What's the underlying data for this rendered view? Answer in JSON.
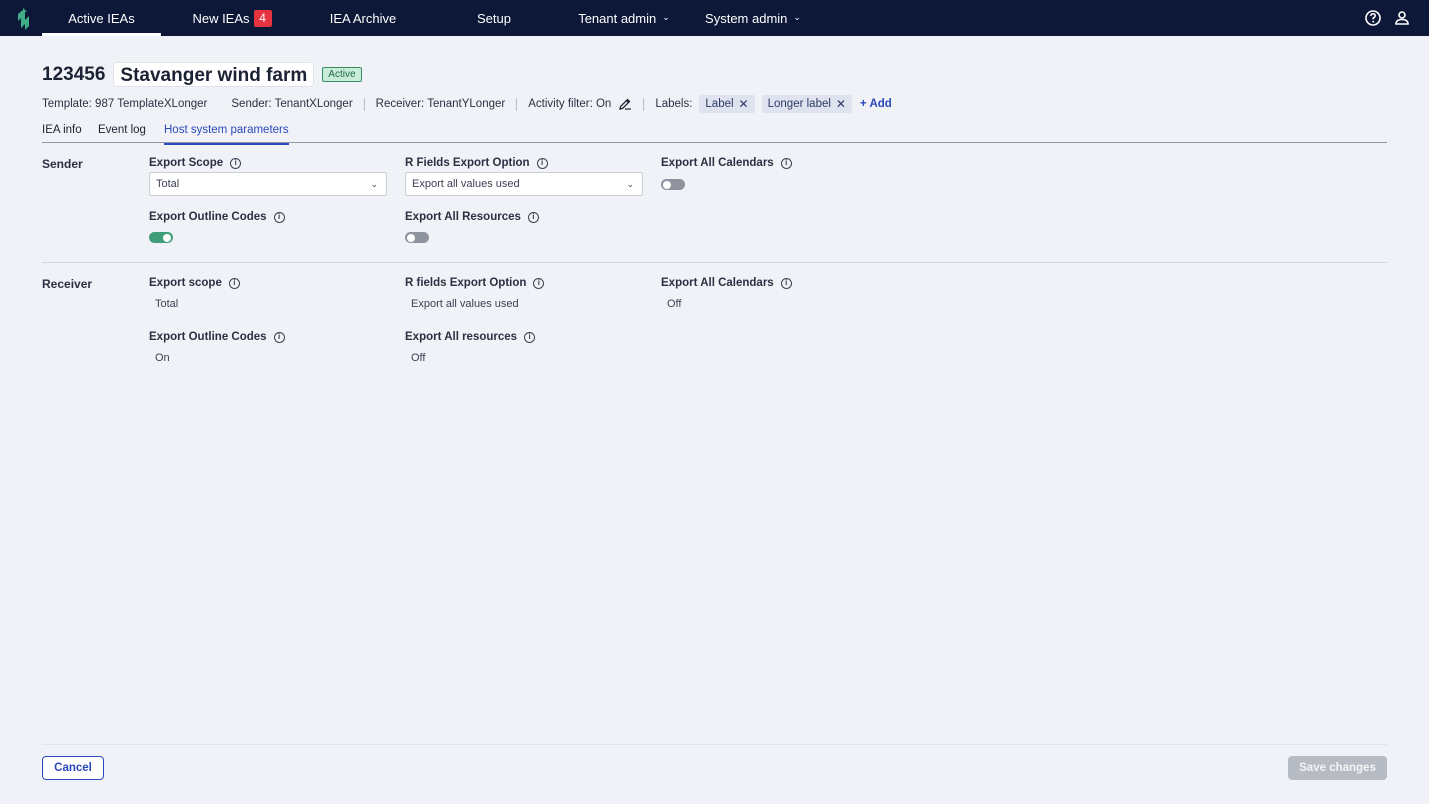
{
  "nav": {
    "items": [
      {
        "label": "Active IEAs"
      },
      {
        "label": "New IEAs",
        "badge": "4"
      },
      {
        "label": "IEA Archive"
      },
      {
        "label": "Setup"
      },
      {
        "label": "Tenant admin"
      },
      {
        "label": "System admin"
      }
    ],
    "help_icon": "help-circle-icon",
    "user_icon": "user-icon",
    "brand_color": "#0d1738",
    "badge_color": "#e5343f"
  },
  "header": {
    "id": "123456",
    "name": "Stavanger wind farm",
    "status": "Active",
    "template": "Template: 987 TemplateXLonger",
    "sender": "Sender: TenantXLonger",
    "receiver": "Receiver: TenantYLonger",
    "activity_filter": "Activity filter: On",
    "labels_title": "Labels:",
    "labels": [
      "Label",
      "Longer label"
    ],
    "add_label": "+ Add"
  },
  "tabs": [
    "IEA info",
    "Event log",
    "Host system parameters"
  ],
  "active_tab": "Host system parameters",
  "sender": {
    "title": "Sender",
    "export_scope_label": "Export Scope",
    "export_scope_value": "Total",
    "r_fields_label": "R Fields Export Option",
    "r_fields_value": "Export all values used",
    "export_calendars_label": "Export All Calendars",
    "export_calendars_on": false,
    "export_outline_label": "Export Outline Codes",
    "export_outline_on": true,
    "export_resources_label": "Export All Resources",
    "export_resources_on": false
  },
  "receiver": {
    "title": "Receiver",
    "export_scope_label": "Export scope",
    "export_scope_value": "Total",
    "r_fields_label": "R fields Export Option",
    "r_fields_value": "Export all values used",
    "export_calendars_label": "Export All Calendars",
    "export_calendars_value": "Off",
    "export_outline_label": "Export Outline Codes",
    "export_outline_value": "On",
    "export_resources_label": "Export All resources",
    "export_resources_value": "Off"
  },
  "footer": {
    "cancel": "Cancel",
    "save": "Save changes"
  }
}
